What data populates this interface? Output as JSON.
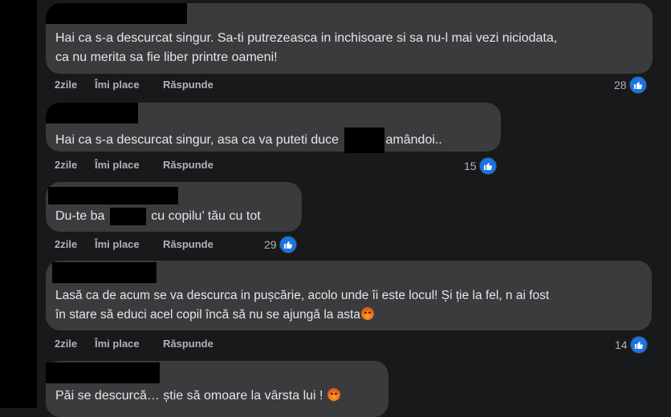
{
  "comments": [
    {
      "text": "Hai ca s-a descurcat singur. Sa-ti putrezeasca in inchisoare si sa nu-l mai vezi niciodata, ca nu merita sa fie liber printre oameni!",
      "line1": "Hai ca s-a descurcat singur. Sa-ti putrezeasca in inchisoare si sa nu-l mai vezi niciodata,",
      "line2": "ca nu merita sa fie liber printre oameni!",
      "time": "2zile",
      "like": "Îmi place",
      "reply": "Răspunde",
      "reactions": "28"
    },
    {
      "part1": "Hai ca s-a descurcat singur, asa ca va puteti duce",
      "part2": "amândoi..",
      "time": "2zile",
      "like": "Îmi place",
      "reply": "Răspunde",
      "reactions": "15"
    },
    {
      "part1": "Du-te ba",
      "part2": "cu copilu’ tău cu tot",
      "time": "2zile",
      "like": "Îmi place",
      "reply": "Răspunde",
      "reactions": "29"
    },
    {
      "line1": "Lasă ca de acum se va descurca in pușcărie, acolo unde îi este locul! Și ție la fel, n ai fost",
      "line2": "în stare să educi acel copil încă să nu se ajungă la asta",
      "time": "2zile",
      "like": "Îmi place",
      "reply": "Răspunde",
      "reactions": "14",
      "emoji": "angry-emoji"
    },
    {
      "text": "Păi se descurcă… știe să omoare la vârsta lui !",
      "emoji": "angry-emoji"
    }
  ],
  "colors": {
    "background": "#18191a",
    "bubble": "#3a3b3c",
    "text": "#e4e6eb",
    "secondary": "#b0b3b8",
    "like_blue": "#1b74e4"
  }
}
